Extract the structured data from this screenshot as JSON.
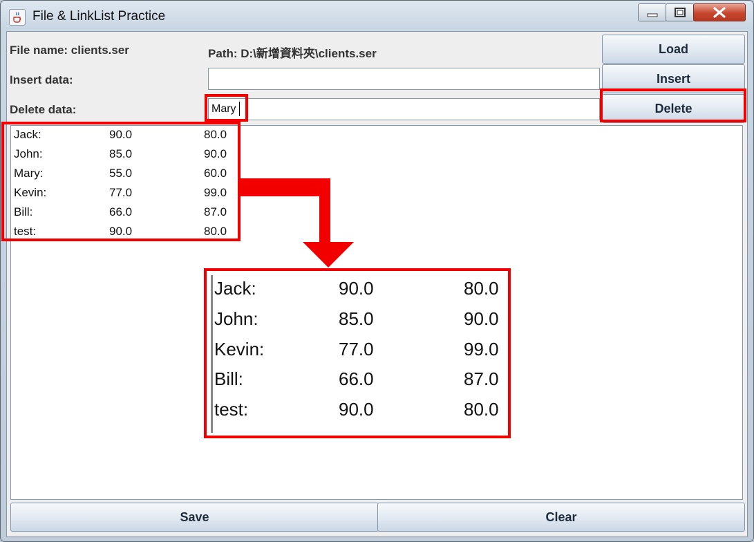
{
  "window": {
    "title": "File & LinkList Practice"
  },
  "header": {
    "file_name_label": "File name: clients.ser",
    "path_label": "Path: D:\\新增資料夾\\clients.ser",
    "insert_label": "Insert data:",
    "delete_label": "Delete data:",
    "insert_value": "",
    "delete_value": "Mary"
  },
  "buttons": {
    "load": "Load",
    "insert": "Insert",
    "delete": "Delete",
    "save": "Save",
    "clear": "Clear"
  },
  "records": [
    {
      "name": "Jack:",
      "v1": "90.0",
      "v2": "80.0"
    },
    {
      "name": "John:",
      "v1": "85.0",
      "v2": "90.0"
    },
    {
      "name": "Mary:",
      "v1": "55.0",
      "v2": "60.0"
    },
    {
      "name": "Kevin:",
      "v1": "77.0",
      "v2": "99.0"
    },
    {
      "name": "Bill:",
      "v1": "66.0",
      "v2": "87.0"
    },
    {
      "name": "test:",
      "v1": "90.0",
      "v2": "80.0"
    }
  ],
  "result_records": [
    {
      "name": "Jack:",
      "v1": "90.0",
      "v2": "80.0"
    },
    {
      "name": "John:",
      "v1": "85.0",
      "v2": "90.0"
    },
    {
      "name": "Kevin:",
      "v1": "77.0",
      "v2": "99.0"
    },
    {
      "name": "Bill:",
      "v1": "66.0",
      "v2": "87.0"
    },
    {
      "name": "test:",
      "v1": "90.0",
      "v2": "80.0"
    }
  ],
  "colors": {
    "highlight": "#f20000",
    "accent": "#cbd8e6"
  },
  "icons": {
    "app": "java-cup-icon",
    "minimize": "minimize-icon",
    "maximize": "maximize-icon",
    "close": "close-icon",
    "arrow": "arrow-down-icon"
  }
}
